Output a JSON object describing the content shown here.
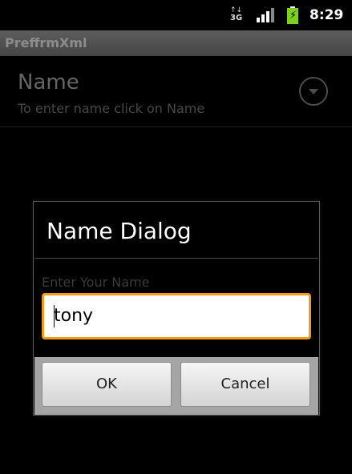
{
  "status_bar": {
    "network_label": "3G",
    "network_arrows": "↑↓",
    "time": "8:29",
    "icons": [
      "network-3g-icon",
      "signal-icon",
      "battery-charging-icon"
    ]
  },
  "app_bar": {
    "title": "PreffrmXml"
  },
  "preference": {
    "title": "Name",
    "summary": "To enter name click on Name",
    "icon": "dropdown-circle-icon"
  },
  "dialog": {
    "title": "Name Dialog",
    "hint": "Enter Your Name",
    "input_value": "tony",
    "buttons": {
      "ok": "OK",
      "cancel": "Cancel"
    }
  },
  "colors": {
    "input_focus_border": "#f29a1a",
    "battery": "#7ad11f",
    "title_bar": "#4d4d4d"
  }
}
